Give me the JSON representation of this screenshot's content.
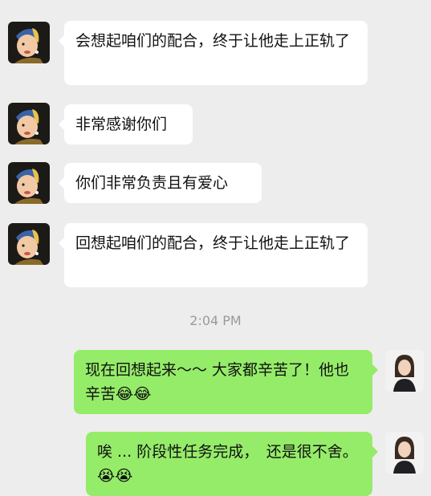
{
  "messages": [
    {
      "side": "in",
      "text": "会想起咱们的配合，终于让他走上正轨了",
      "avatar_icon": "girl-with-pearl-earring-avatar"
    },
    {
      "side": "in",
      "text": "非常感谢你们",
      "avatar_icon": "girl-with-pearl-earring-avatar"
    },
    {
      "side": "in",
      "text": "你们非常负责且有爱心",
      "avatar_icon": "girl-with-pearl-earring-avatar"
    },
    {
      "side": "in",
      "text": "回想起咱们的配合，终于让他走上正轨了",
      "avatar_icon": "girl-with-pearl-earring-avatar"
    },
    {
      "side": "out",
      "text": "现在回想起来～～ 大家都辛苦了！他也辛苦",
      "emoji": "😂😂",
      "avatar_icon": "woman-photo-avatar"
    },
    {
      "side": "out",
      "text": "唉 ... 阶段性任务完成，　还是很不舍。",
      "emoji": "😭😭",
      "avatar_icon": "woman-photo-avatar"
    }
  ],
  "timestamp": "2:04 PM",
  "colors": {
    "background": "#ededed",
    "incoming_bubble": "#ffffff",
    "outgoing_bubble": "#95ec69",
    "timestamp_text": "#9a9a9a"
  }
}
